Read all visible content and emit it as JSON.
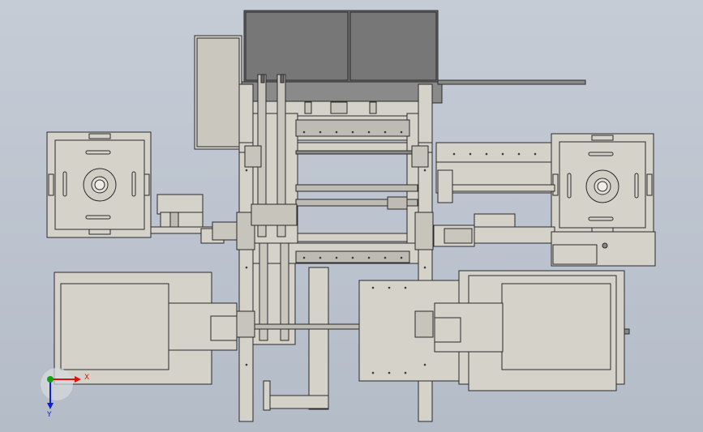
{
  "viewport": {
    "background_top": "#c5ccd6",
    "background_bottom": "#b4bcc8",
    "part_fill": "#d4d2c9",
    "part_stroke": "#3a3a3a",
    "dark_panel": "#6b6b6b"
  },
  "triad": {
    "x_label": "X",
    "y_label": "Y",
    "x_color": "#e01010",
    "y_color": "#10a010",
    "z_color": "#1020d0"
  }
}
